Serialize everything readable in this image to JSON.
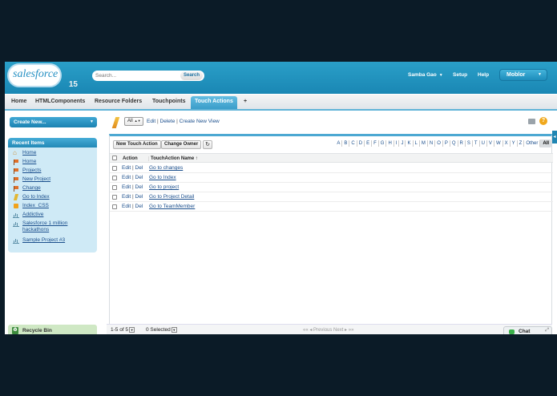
{
  "header": {
    "logo_text": "salesforce",
    "logo_number": "15",
    "search_placeholder": "Search...",
    "search_button": "Search",
    "user_name": "Samba Gao",
    "setup": "Setup",
    "help": "Help",
    "app_menu": "Moblor"
  },
  "tabs": [
    {
      "label": "Home"
    },
    {
      "label": "HTMLComponents"
    },
    {
      "label": "Resource Folders"
    },
    {
      "label": "Touchpoints"
    },
    {
      "label": "Touch Actions",
      "active": true
    },
    {
      "label": "+"
    }
  ],
  "sidebar": {
    "create_new": "Create New...",
    "recent_title": "Recent Items",
    "items": [
      {
        "label": "Home",
        "icon": "home-icon"
      },
      {
        "label": "Home",
        "icon": "flag-icon"
      },
      {
        "label": "Projects",
        "icon": "flag-icon"
      },
      {
        "label": "New Project",
        "icon": "flag-icon"
      },
      {
        "label": "Change",
        "icon": "flag-icon"
      },
      {
        "label": "Go to Index",
        "icon": "bolt-icon"
      },
      {
        "label": "Index_CSS",
        "icon": "css-icon"
      },
      {
        "label": "Addictive",
        "icon": "bars-icon"
      },
      {
        "label": "Salesforce 1 million",
        "label2": "hackathons",
        "icon": "bars-icon"
      },
      {
        "label": "Sample Project #3",
        "icon": "bars-icon"
      }
    ],
    "recycle_bin": "Recycle Bin"
  },
  "main": {
    "view_select": "All",
    "edit_link": "Edit",
    "delete_link": "Delete",
    "create_view_link": "Create New View",
    "new_button": "New Touch Action",
    "change_owner_button": "Change Owner",
    "alphabet": [
      "A",
      "B",
      "C",
      "D",
      "E",
      "F",
      "G",
      "H",
      "I",
      "J",
      "K",
      "L",
      "M",
      "N",
      "O",
      "P",
      "Q",
      "R",
      "S",
      "T",
      "U",
      "V",
      "W",
      "X",
      "Y",
      "Z",
      "Other",
      "All"
    ],
    "alphabet_active": "All",
    "col_action": "Action",
    "col_name": "TouchAction Name",
    "sort_indicator": "↑",
    "edit": "Edit",
    "del": "Del",
    "rows": [
      {
        "name": "Go to changes"
      },
      {
        "name": "Go to Index"
      },
      {
        "name": "Go to project"
      },
      {
        "name": "Go to Project Detail"
      },
      {
        "name": "Go to TeamMember"
      }
    ],
    "pager": "1-5 of 5",
    "selected": "0 Selected",
    "prev": "Previous",
    "next": "Next"
  },
  "chat": "Chat"
}
